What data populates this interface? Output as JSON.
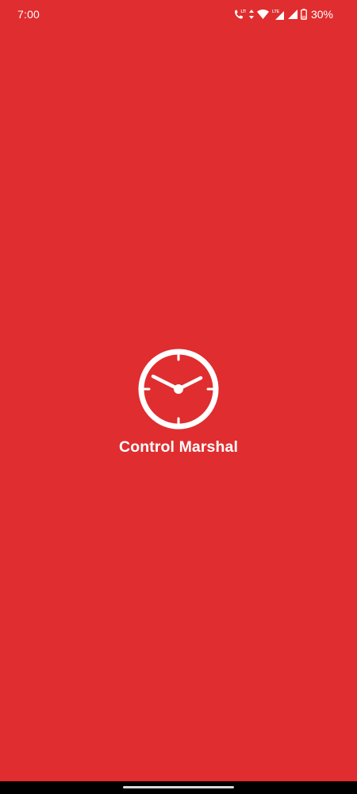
{
  "status_bar": {
    "time": "7:00",
    "icons": [
      "call-lte-icon",
      "wifi-icon",
      "cell-signal-lte-icon",
      "cell-signal-icon",
      "battery-low-icon"
    ],
    "lte_label": "LTE",
    "battery_percent": "30%",
    "battery_color": "#FF8A80"
  },
  "splash": {
    "logo_icon": "clock-icon",
    "app_name": "Control Marshal"
  },
  "colors": {
    "background": "#E02D2F",
    "foreground": "#FFFFFF",
    "nav_bar": "#000000"
  }
}
